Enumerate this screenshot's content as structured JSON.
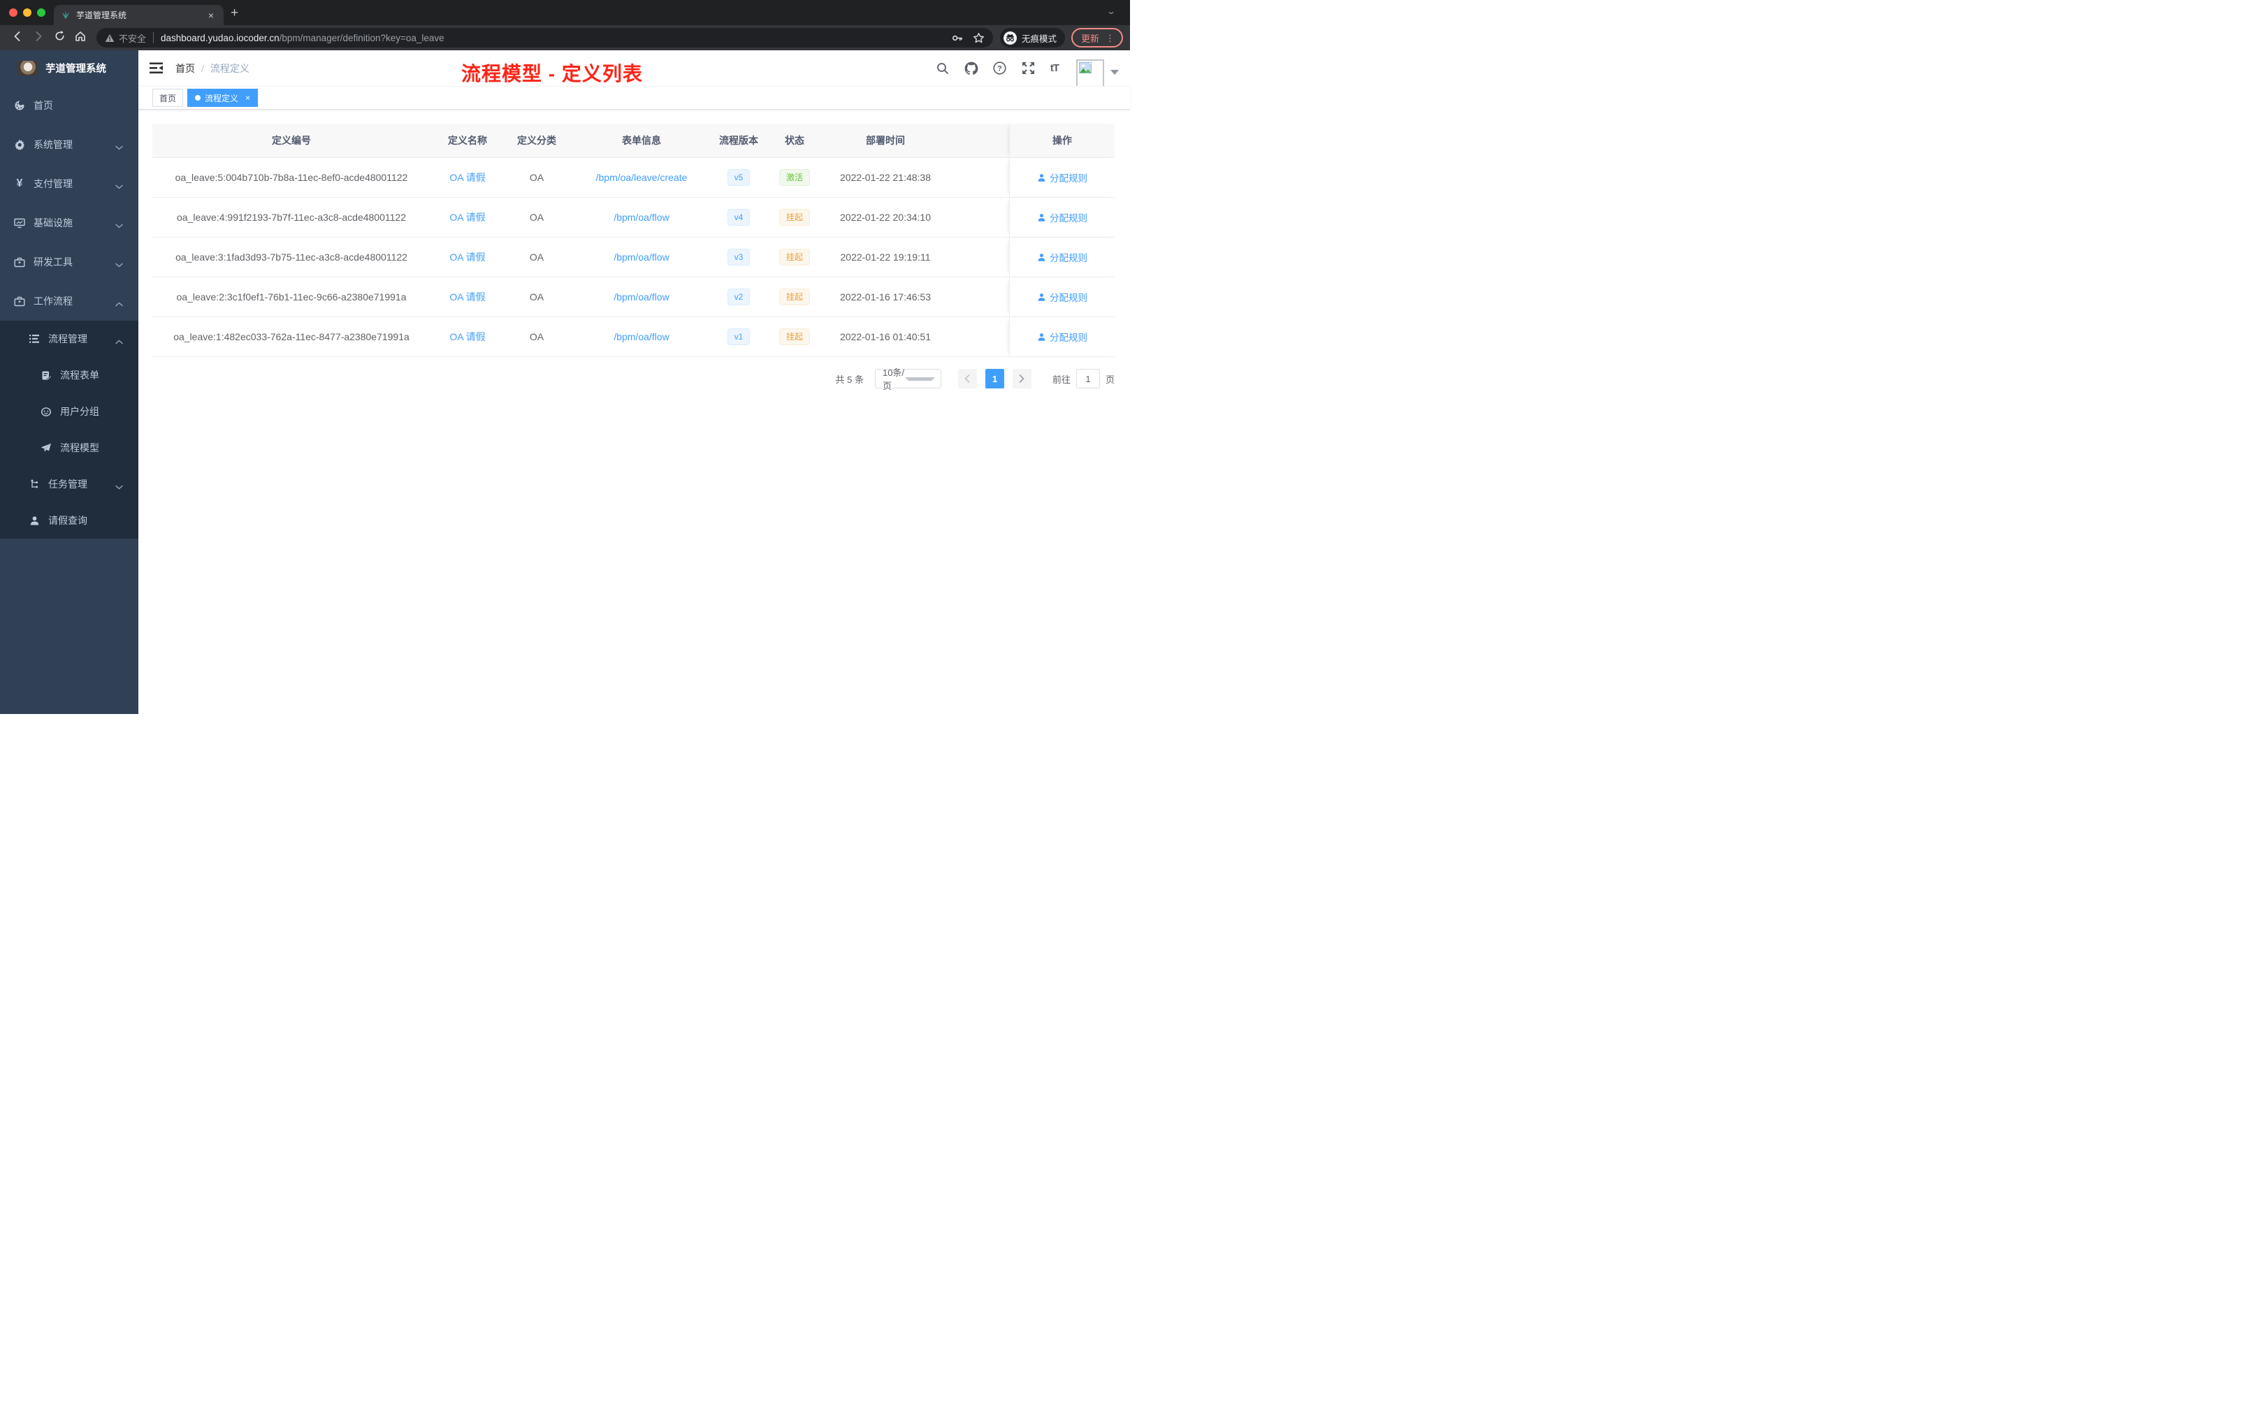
{
  "browser": {
    "tab": {
      "title": "芋道管理系统",
      "close": "×",
      "new_tab": "+"
    },
    "toolbar": {
      "security": "不安全",
      "url_domain": "dashboard.yudao.iocoder.cn",
      "url_path": "/bpm/manager/definition?key=oa_leave",
      "incognito": "无痕模式",
      "update": "更新",
      "menu_dots": "⋮"
    }
  },
  "sidebar": {
    "title": "芋道管理系统",
    "menu": [
      {
        "label": "首页"
      },
      {
        "label": "系统管理"
      },
      {
        "label": "支付管理"
      },
      {
        "label": "基础设施"
      },
      {
        "label": "研发工具"
      },
      {
        "label": "工作流程"
      },
      {
        "label": "流程管理"
      },
      {
        "label": "流程表单"
      },
      {
        "label": "用户分组"
      },
      {
        "label": "流程模型"
      },
      {
        "label": "任务管理"
      },
      {
        "label": "请假查询"
      }
    ]
  },
  "navbar": {
    "breadcrumb_home": "首页",
    "breadcrumb_sep": "/",
    "breadcrumb_current": "流程定义",
    "annotation": "流程模型 - 定义列表",
    "font_size_icon": "tT"
  },
  "tags": {
    "home": "首页",
    "active": "流程定义",
    "close": "×"
  },
  "table": {
    "columns": {
      "id": "定义编号",
      "name": "定义名称",
      "category": "定义分类",
      "form": "表单信息",
      "version": "流程版本",
      "status": "状态",
      "deploy_time": "部署时间",
      "actions": "操作"
    },
    "action_label": "分配规则",
    "rows": [
      {
        "id": "oa_leave:5:004b710b-7b8a-11ec-8ef0-acde48001122",
        "name": "OA 请假",
        "category": "OA",
        "form": "/bpm/oa/leave/create",
        "version": "v5",
        "status": "激活",
        "time": "2022-01-22 21:48:38"
      },
      {
        "id": "oa_leave:4:991f2193-7b7f-11ec-a3c8-acde48001122",
        "name": "OA 请假",
        "category": "OA",
        "form": "/bpm/oa/flow",
        "version": "v4",
        "status": "挂起",
        "time": "2022-01-22 20:34:10"
      },
      {
        "id": "oa_leave:3:1fad3d93-7b75-11ec-a3c8-acde48001122",
        "name": "OA 请假",
        "category": "OA",
        "form": "/bpm/oa/flow",
        "version": "v3",
        "status": "挂起",
        "time": "2022-01-22 19:19:11"
      },
      {
        "id": "oa_leave:2:3c1f0ef1-76b1-11ec-9c66-a2380e71991a",
        "name": "OA 请假",
        "category": "OA",
        "form": "/bpm/oa/flow",
        "version": "v2",
        "status": "挂起",
        "time": "2022-01-16 17:46:53"
      },
      {
        "id": "oa_leave:1:482ec033-762a-11ec-8477-a2380e71991a",
        "name": "OA 请假",
        "category": "OA",
        "form": "/bpm/oa/flow",
        "version": "v1",
        "status": "挂起",
        "time": "2022-01-16 01:40:51"
      }
    ]
  },
  "pagination": {
    "total": "共 5 条",
    "page_size": "10条/页",
    "page": "1",
    "goto": "前往",
    "unit": "页",
    "goto_value": "1"
  },
  "colors": {
    "accent": "#409eff",
    "success": "#67c23a",
    "warning": "#e6a23c",
    "annotation_red": "#fd2417",
    "sidebar_bg": "#304156",
    "submenu_bg": "#1f2d3d"
  }
}
